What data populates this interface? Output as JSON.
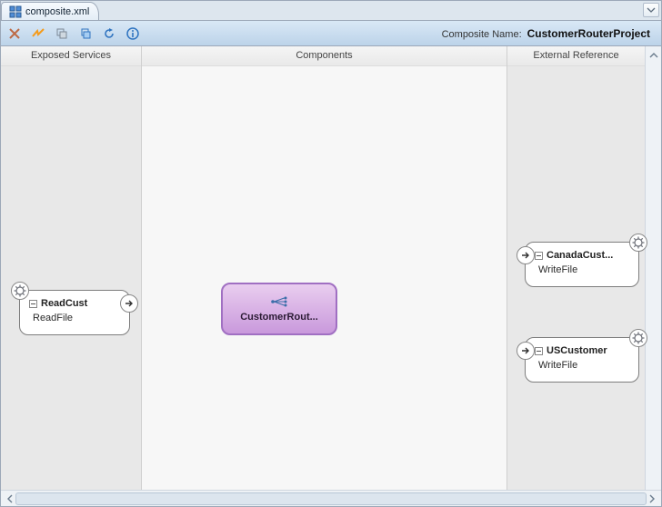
{
  "tab": {
    "filename": "composite.xml"
  },
  "toolbar": {
    "composite_name_label": "Composite Name:",
    "composite_name_value": "CustomerRouterProject"
  },
  "columns": {
    "exposed": "Exposed Services",
    "components": "Components",
    "external": "External Reference"
  },
  "exposed": {
    "readcust": {
      "title": "ReadCust",
      "subtitle": "ReadFile"
    }
  },
  "components": {
    "router": {
      "label": "CustomerRout..."
    }
  },
  "external": {
    "canada": {
      "title": "CanadaCust...",
      "subtitle": "WriteFile"
    },
    "us": {
      "title": "USCustomer",
      "subtitle": "WriteFile"
    }
  }
}
